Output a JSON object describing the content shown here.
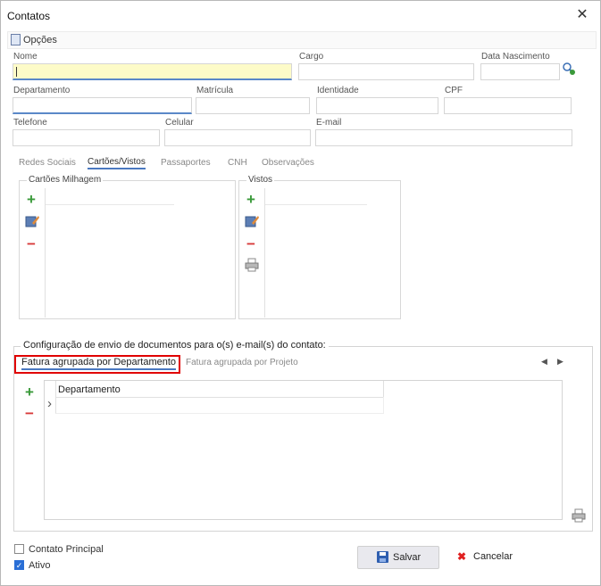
{
  "window": {
    "title": "Contatos",
    "close": "✕"
  },
  "options": {
    "label": "Opções"
  },
  "fields": {
    "nome": "Nome",
    "cargo": "Cargo",
    "data_nascimento": "Data Nascimento",
    "departamento": "Departamento",
    "matricula": "Matrícula",
    "identidade": "Identidade",
    "cpf": "CPF",
    "telefone": "Telefone",
    "celular": "Celular",
    "email": "E-mail"
  },
  "tabs": [
    "Redes Sociais",
    "Cartões/Vistos",
    "Passaportes",
    "CNH",
    "Observações"
  ],
  "groups": {
    "cartoes": "Cartões Milhagem",
    "vistos": "Vistos"
  },
  "config": {
    "title": "Configuração de envio de documentos para o(s) e-mail(s) do contato:",
    "tab_active": "Fatura agrupada por Departamento",
    "tab_other": "Fatura agrupada por Projeto",
    "nav_prev": "◀",
    "nav_next": "▶",
    "grid_header": "Departamento",
    "row_indicator": "›"
  },
  "icons": {
    "plus": "+",
    "minus": "−",
    "check": "✓",
    "save_x": "✖"
  },
  "footer": {
    "contato_principal": "Contato Principal",
    "ativo": "Ativo",
    "ativo_checked": true,
    "save": "Salvar",
    "cancel": "Cancelar"
  }
}
